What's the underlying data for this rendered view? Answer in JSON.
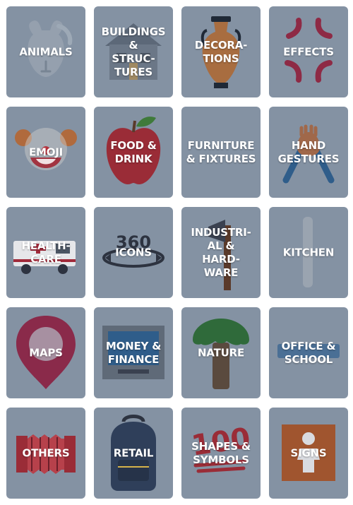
{
  "tiles": [
    {
      "label": "ANIMALS",
      "icon": "llama-icon"
    },
    {
      "label": "BUILDINGS\n&\nSTRUC-\nTURES",
      "icon": "house-icon"
    },
    {
      "label": "DECORA-\nTIONS",
      "icon": "vase-icon"
    },
    {
      "label": "EFFECTS",
      "icon": "anger-symbol-icon"
    },
    {
      "label": "EMOJI",
      "icon": "clown-face-icon"
    },
    {
      "label": "FOOD &\nDRINK",
      "icon": "apple-icon"
    },
    {
      "label": "FURNITURE\n& FIXTURES",
      "icon": "furniture-icon"
    },
    {
      "label": "HAND\nGESTURES",
      "icon": "raised-hands-icon"
    },
    {
      "label": "HEALTH-\nCARE",
      "icon": "ambulance-icon"
    },
    {
      "label": "ICONS",
      "icon": "360-icon"
    },
    {
      "label": "INDUSTRI-\nAL &\nHARD-\nWARE",
      "icon": "axe-icon"
    },
    {
      "label": "KITCHEN",
      "icon": "rolling-pin-icon"
    },
    {
      "label": "MAPS",
      "icon": "map-pin-icon"
    },
    {
      "label": "MONEY &\nFINANCE",
      "icon": "atm-icon"
    },
    {
      "label": "NATURE",
      "icon": "tree-icon"
    },
    {
      "label": "OFFICE &\nSCHOOL",
      "icon": "office-icon"
    },
    {
      "label": "OTHERS",
      "icon": "accordion-icon"
    },
    {
      "label": "RETAIL",
      "icon": "backpack-icon"
    },
    {
      "label": "SHAPES &\nSYMBOLS",
      "icon": "hundred-points-icon"
    },
    {
      "label": "SIGNS",
      "icon": "baby-sign-icon"
    }
  ],
  "colors": {
    "tile_background": "#8492a3",
    "label": "#ffffff"
  }
}
